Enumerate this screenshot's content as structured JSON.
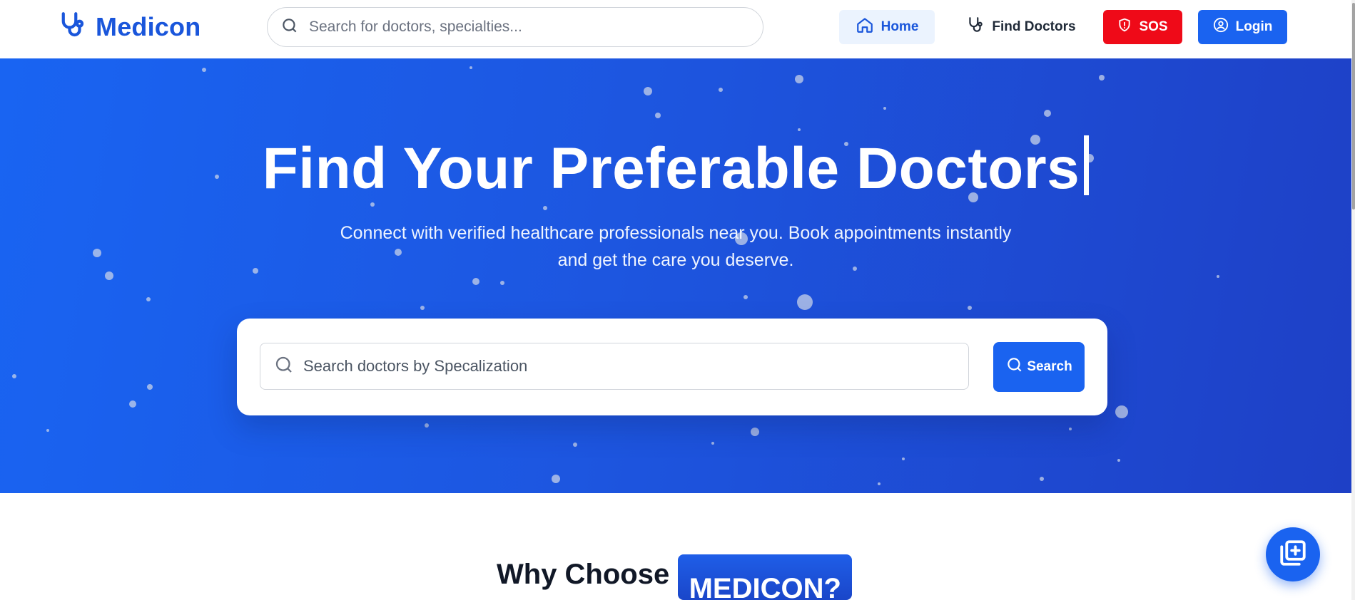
{
  "brand": {
    "name": "Medicon",
    "icon": "stethoscope-icon"
  },
  "nav": {
    "search_placeholder": "Search for doctors, specialties...",
    "home_label": "Home",
    "find_doctors_label": "Find Doctors",
    "sos_label": "SOS",
    "login_label": "Login"
  },
  "hero": {
    "title": "Find Your Preferable Doctors",
    "subtitle_line1": "Connect with verified healthcare professionals near you. Book appointments instantly",
    "subtitle_line2": "and get the care you deserve.",
    "search_placeholder": "Search doctors by Specalization",
    "search_button": "Search"
  },
  "why": {
    "prefix": "Why Choose",
    "highlight": "MEDICON?"
  },
  "fab": {
    "icon": "add-appointment-icon"
  },
  "colors": {
    "primary": "#1a63f0",
    "brand_text": "#1a56db",
    "sos": "#ef0a18",
    "hero_start": "#1964f2",
    "hero_end": "#1e40c6"
  }
}
